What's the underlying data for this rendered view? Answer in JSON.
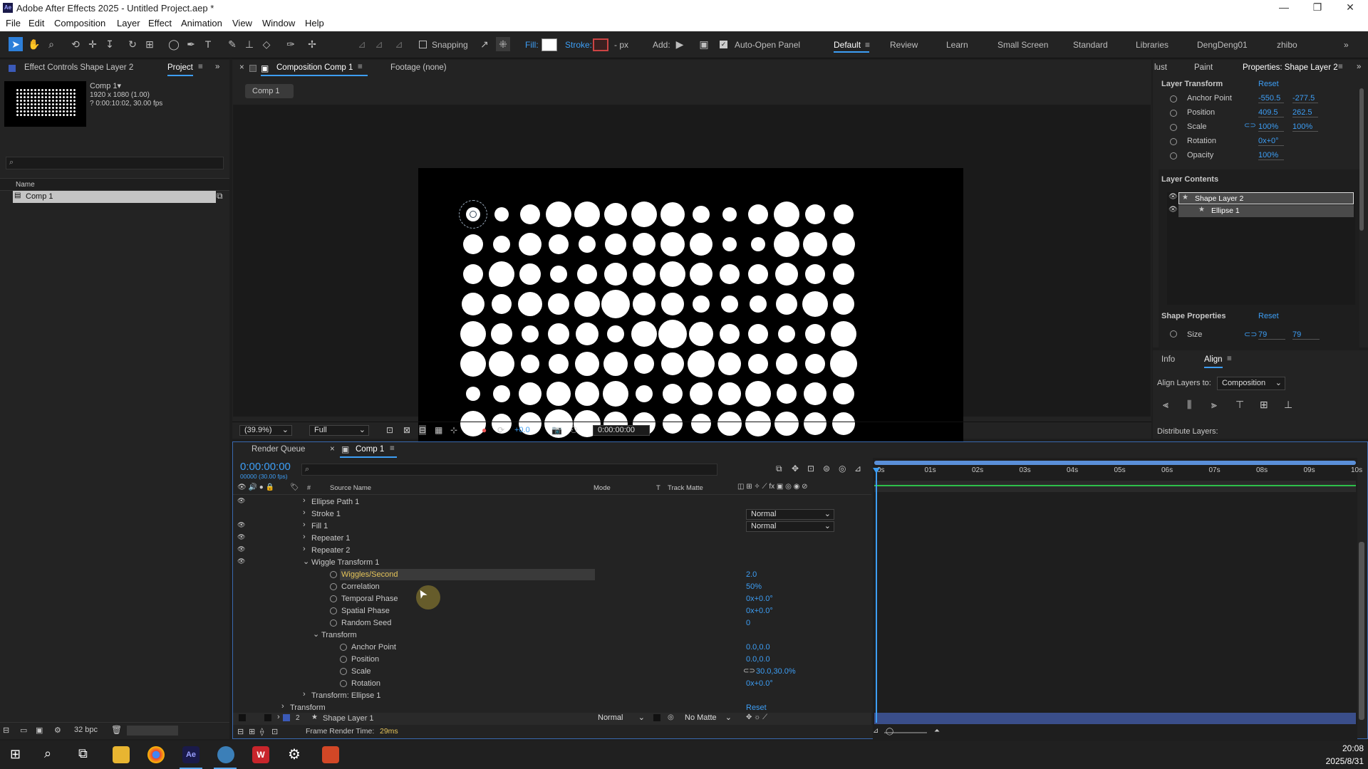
{
  "window": {
    "title": "Adobe After Effects 2025 - Untitled Project.aep *",
    "logo": "Ae"
  },
  "menu": [
    "File",
    "Edit",
    "Composition",
    "Layer",
    "Effect",
    "Animation",
    "View",
    "Window",
    "Help"
  ],
  "toolbar": {
    "fill_label": "Fill:",
    "stroke_label": "Stroke:",
    "stroke_px": "- px",
    "add_label": "Add:",
    "snapping": "Snapping",
    "auto_open": "Auto-Open Panel",
    "workspaces": [
      "Default",
      "Review",
      "Learn",
      "Small Screen",
      "Standard",
      "Libraries",
      "DengDeng01",
      "zhibo"
    ]
  },
  "left_panel": {
    "tab_effect": "Effect Controls Shape Layer 2",
    "tab_project": "Project",
    "comp_name": "Comp 1▾",
    "comp_info1": "1920 x 1080 (1.00)",
    "comp_info2": "? 0:00:10:02, 30.00 fps",
    "col_name": "Name",
    "item": "Comp 1",
    "bpc": "32 bpc"
  },
  "viewer": {
    "tab_comp": "Composition Comp 1",
    "tab_footage": "Footage (none)",
    "crumb": "Comp 1",
    "zoom": "(39.9%)",
    "quality": "Full",
    "exposure": "+0.0",
    "timecode": "0:00:00:00"
  },
  "props": {
    "tab_adjust": "lust",
    "tab_paint": "Paint",
    "tab_props": "Properties: Shape Layer 2",
    "layer_transform": "Layer Transform",
    "reset": "Reset",
    "rows": [
      {
        "name": "Anchor Point",
        "v1": "-550.5",
        "v2": "-277.5"
      },
      {
        "name": "Position",
        "v1": "409.5",
        "v2": "262.5"
      },
      {
        "name": "Scale",
        "v1": "100%",
        "v2": "100%"
      },
      {
        "name": "Rotation",
        "v1": "0x+0°",
        "v2": ""
      },
      {
        "name": "Opacity",
        "v1": "100%",
        "v2": ""
      }
    ],
    "layer_contents": "Layer Contents",
    "lc_items": [
      "Shape Layer 2",
      "Ellipse 1"
    ],
    "shape_props": "Shape Properties",
    "size_label": "Size",
    "size_w": "79",
    "size_h": "79"
  },
  "align": {
    "tab_info": "Info",
    "tab_align": "Align",
    "align_to_label": "Align Layers to:",
    "align_to": "Composition",
    "distribute": "Distribute Layers:"
  },
  "timeline": {
    "tab_rq": "Render Queue",
    "tab_comp": "Comp 1",
    "timecode": "0:00:00:00",
    "fps": "00000 (30.00 fps)",
    "cols": {
      "source": "Source Name",
      "mode": "Mode",
      "t": "T",
      "matte": "Track Matte"
    },
    "ruler": [
      "0s",
      "01s",
      "02s",
      "03s",
      "04s",
      "05s",
      "06s",
      "07s",
      "08s",
      "09s",
      "10s"
    ],
    "rows": [
      {
        "indent": 0,
        "twirl": "›",
        "name": "Ellipse Path 1",
        "val": "",
        "eye": true
      },
      {
        "indent": 0,
        "twirl": "›",
        "name": "Stroke 1",
        "val": "",
        "mode": "Normal",
        "eye": false
      },
      {
        "indent": 0,
        "twirl": "›",
        "name": "Fill 1",
        "val": "",
        "mode": "Normal",
        "eye": true
      },
      {
        "indent": 0,
        "twirl": "›",
        "name": "Repeater 1",
        "val": "",
        "eye": true
      },
      {
        "indent": 0,
        "twirl": "›",
        "name": "Repeater 2",
        "val": "",
        "eye": true
      },
      {
        "indent": 0,
        "twirl": "⌄",
        "name": "Wiggle Transform 1",
        "val": "",
        "eye": true
      },
      {
        "indent": 2,
        "twirl": "",
        "name": "Wiggles/Second",
        "val": "2.0",
        "stop": true,
        "sel": true
      },
      {
        "indent": 2,
        "twirl": "",
        "name": "Correlation",
        "val": "50%",
        "stop": true
      },
      {
        "indent": 2,
        "twirl": "",
        "name": "Temporal Phase",
        "val": "0x+0.0°",
        "stop": true
      },
      {
        "indent": 2,
        "twirl": "",
        "name": "Spatial Phase",
        "val": "0x+0.0°",
        "stop": true
      },
      {
        "indent": 2,
        "twirl": "",
        "name": "Random Seed",
        "val": "0",
        "stop": true
      },
      {
        "indent": 1,
        "twirl": "⌄",
        "name": "Transform",
        "val": ""
      },
      {
        "indent": 3,
        "twirl": "",
        "name": "Anchor Point",
        "val": "0.0,0.0",
        "stop": true
      },
      {
        "indent": 3,
        "twirl": "",
        "name": "Position",
        "val": "0.0,0.0",
        "stop": true
      },
      {
        "indent": 3,
        "twirl": "",
        "name": "Scale",
        "val": "30.0,30.0%",
        "stop": true,
        "link": true
      },
      {
        "indent": 3,
        "twirl": "",
        "name": "Rotation",
        "val": "0x+0.0°",
        "stop": true
      },
      {
        "indent": 0,
        "twirl": "›",
        "name": "Transform: Ellipse 1",
        "val": ""
      },
      {
        "indent": -1,
        "twirl": "›",
        "name": "Transform",
        "val": "Reset"
      }
    ],
    "layer2": {
      "num": "2",
      "name": "Shape Layer 1",
      "mode": "Normal",
      "matte": "No Matte"
    },
    "frame_render_label": "Frame Render Time:",
    "frame_render": "29ms"
  },
  "taskbar": {
    "time": "20:08",
    "date": "2025/8/31"
  },
  "colors": {
    "accent": "#3d9ef5",
    "panel": "#232323",
    "bg": "#1d1d1d"
  }
}
